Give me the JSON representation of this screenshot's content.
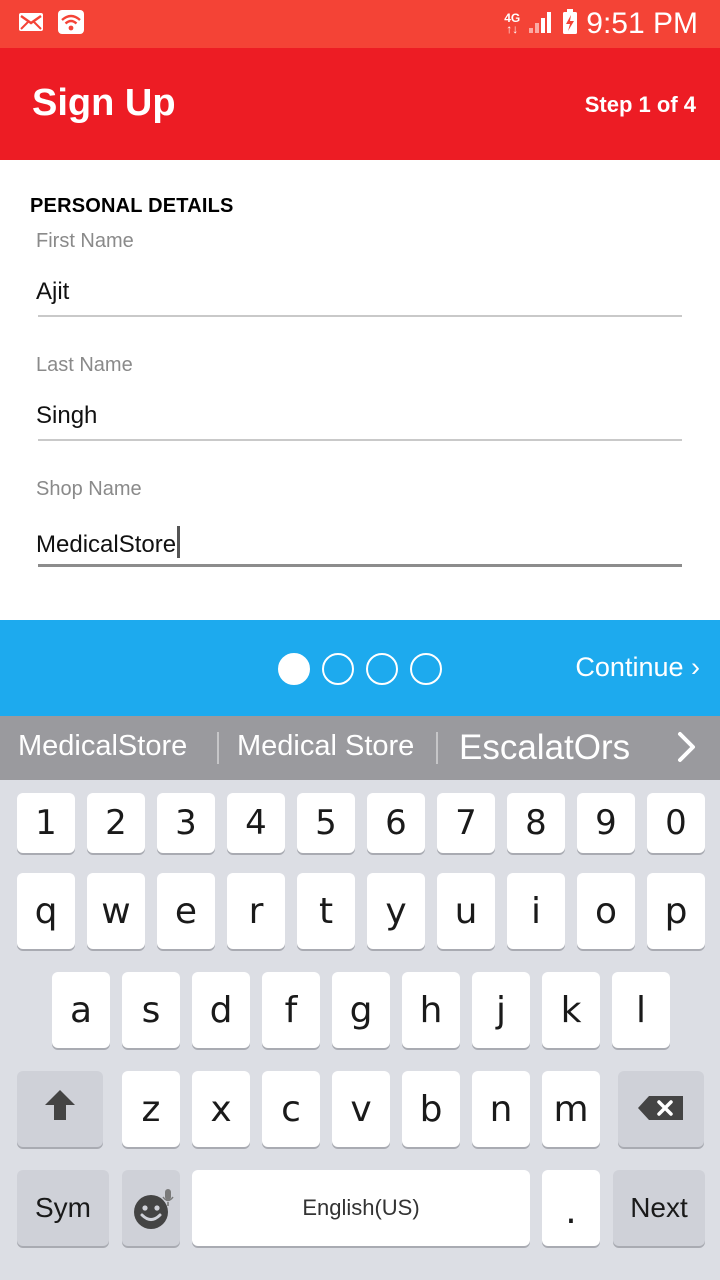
{
  "status_bar": {
    "network_label_top": "4G",
    "network_label_bottom": "↑↓",
    "time": "9:51 PM",
    "icons": [
      "email-icon",
      "wifi-icon",
      "signal-icon",
      "battery-charging-icon"
    ]
  },
  "app_bar": {
    "title": "Sign Up",
    "step": "Step 1 of 4",
    "color": "#ed1c24"
  },
  "form": {
    "section_title": "PERSONAL DETAILS",
    "fields": [
      {
        "label": "First Name",
        "value": "Ajit"
      },
      {
        "label": "Last Name",
        "value": "Singh"
      },
      {
        "label": "Shop Name",
        "value": "MedicalStore"
      }
    ]
  },
  "pager": {
    "pages": 4,
    "current": 1,
    "continue_label": "Continue ›",
    "color": "#1daaee"
  },
  "suggestions": {
    "items": [
      "MedicalStore",
      "Medical Store",
      "EscalatOrs"
    ],
    "more_icon": "chevron-right-icon"
  },
  "keyboard": {
    "numbers": [
      "1",
      "2",
      "3",
      "4",
      "5",
      "6",
      "7",
      "8",
      "9",
      "0"
    ],
    "row1": [
      "q",
      "w",
      "e",
      "r",
      "t",
      "y",
      "u",
      "i",
      "o",
      "p"
    ],
    "row2": [
      "a",
      "s",
      "d",
      "f",
      "g",
      "h",
      "j",
      "k",
      "l"
    ],
    "row3": [
      "z",
      "x",
      "c",
      "v",
      "b",
      "n",
      "m"
    ],
    "sym_label": "Sym",
    "space_label": "English(US)",
    "period_label": ".",
    "next_label": "Next",
    "shift_icon": "shift-arrow-icon",
    "backspace_icon": "backspace-icon",
    "emoji_icon": "emoji-icon",
    "mic_icon": "mic-icon"
  }
}
